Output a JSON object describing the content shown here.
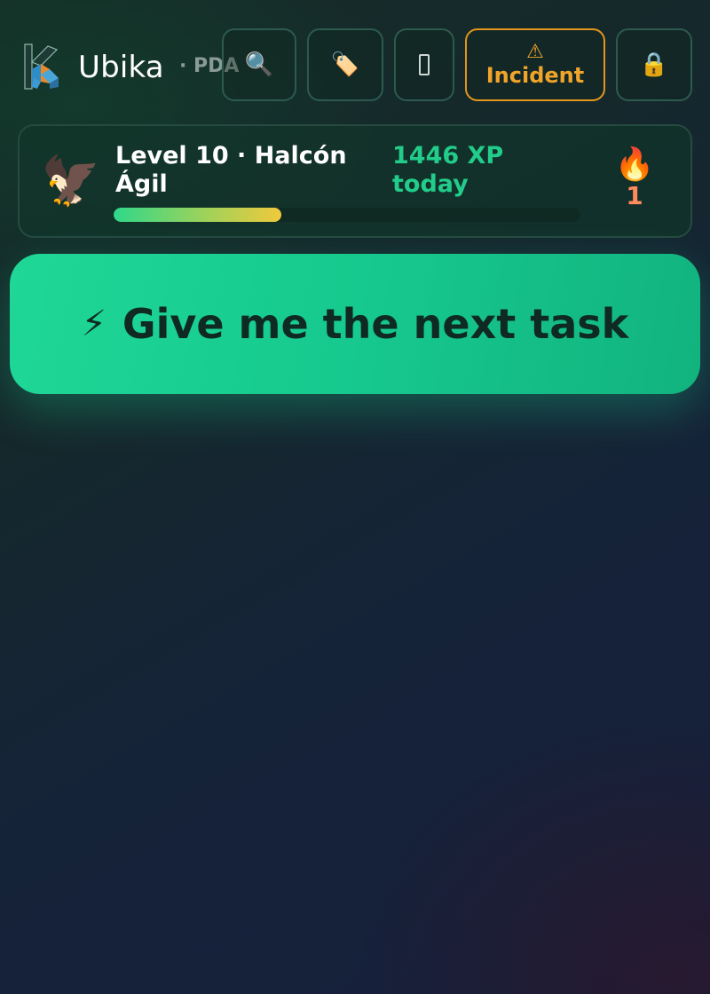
{
  "header": {
    "brand": "Ubika",
    "brand_suffix": "· PDA",
    "buttons": {
      "search_icon": "🔍",
      "tag_icon": "🏷️",
      "incident_icon": "⚠",
      "incident_label": "Incident",
      "lock_icon": "🔒"
    }
  },
  "level": {
    "avatar": "🦅",
    "title": "Level 10 · Halcón Ágil",
    "xp_today": "1446 XP today",
    "progress_fraction": 0.36,
    "streak_icon": "🔥",
    "streak_count": "1"
  },
  "cta": {
    "icon": "⚡",
    "label": "Give me the next task"
  },
  "colors": {
    "accent_green": "#1fd797",
    "incident_orange": "#e3961c",
    "xp_green": "#22cc8a",
    "streak_orange": "#ff8a5c"
  }
}
